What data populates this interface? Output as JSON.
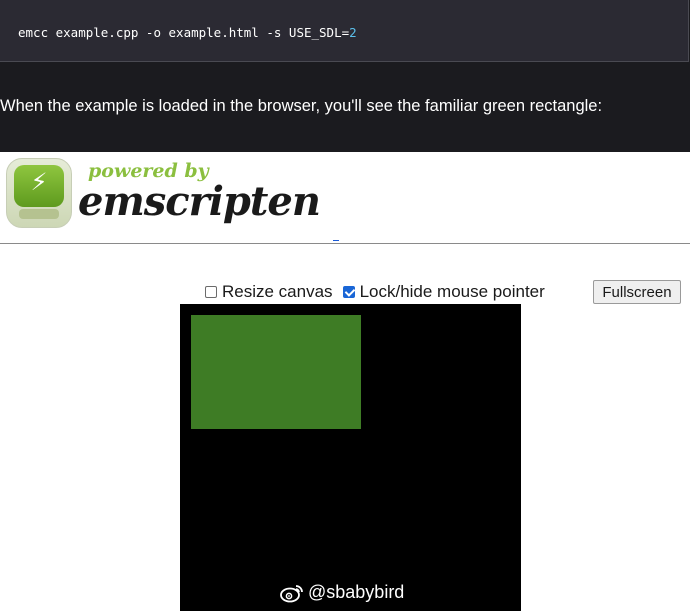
{
  "code": {
    "command": "emcc example.cpp -o example.html -s USE_SDL=",
    "sdl_value": "2"
  },
  "prose": {
    "text": "When the example is loaded in the browser, you'll see the familiar green rectangle:"
  },
  "logo": {
    "tagline": "powered by",
    "name": "emscripten",
    "icon": "lightning-bolt-badge-icon"
  },
  "controls": {
    "resize_label": "Resize canvas",
    "resize_checked": false,
    "lock_label": "Lock/hide mouse pointer",
    "lock_checked": true,
    "fullscreen_label": "Fullscreen"
  },
  "canvas": {
    "background": "#000000",
    "rect_color": "#3e7c25"
  },
  "watermark": {
    "icon": "weibo-icon",
    "text": "@sbabybird"
  },
  "colors": {
    "page_dark": "#1b1b1f",
    "code_bg": "#2b2a33",
    "code_number": "#5bc0eb",
    "logo_green": "#8bbf3f",
    "checkbox_checked": "#1a66d6"
  }
}
